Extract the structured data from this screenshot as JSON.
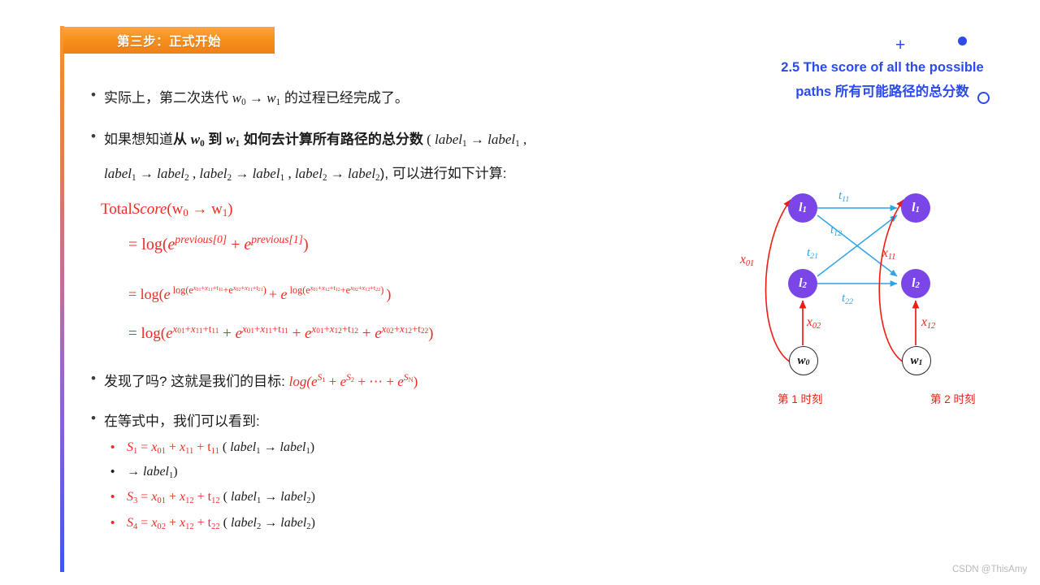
{
  "banner": {
    "title": "第三步：正式开始"
  },
  "right_heading": {
    "line1": "2.5 The score of all the possible",
    "line2": "paths 所有可能路径的总分数",
    "plus_glyph": "+",
    "dot_icon": "filled-dot",
    "circle_icon": "open-circle"
  },
  "bullets": {
    "b1": {
      "marker": "•",
      "pre": "实际上，第二次迭代 ",
      "w0": "w",
      "w0sub": "0",
      "arrow": " → ",
      "w1": "w",
      "w1sub": "1",
      "post": " 的过程已经完成了。"
    },
    "b2": {
      "marker": "•",
      "l1_pre": "如果想知道",
      "l1_bold_a": "从 ",
      "l1_w0": "w",
      "l1_w0sub": "0",
      "l1_bold_b": " 到 ",
      "l1_w1": "w",
      "l1_w1sub": "1",
      "l1_bold_c": " 如何去计算所有路径的总分数",
      "l1_tail": " ( ",
      "l1_lab1": "label",
      "l1_lab1sub": "1",
      "l1_arr": " → ",
      "l1_lab2": "label",
      "l1_lab2sub": "1",
      "l1_comma": " ,",
      "l2_a1": "label",
      "l2_a1sub": "1",
      "l2_arr1": " → ",
      "l2_a2": "label",
      "l2_a2sub": "2",
      "l2_c1": " , ",
      "l2_b1": "label",
      "l2_b1sub": "2",
      "l2_arr2": " → ",
      "l2_b2": "label",
      "l2_b2sub": "1",
      "l2_c2": " , ",
      "l2_d1": "label",
      "l2_d1sub": "2",
      "l2_arr3": " → ",
      "l2_d2": "label",
      "l2_d2sub": "2",
      "l2_tail": "), 可以进行如下计算:"
    },
    "b3": {
      "marker": "•",
      "pre": "发现了吗? 这就是我们的目标: ",
      "formula_log": "log(",
      "s1": "S",
      "s1sub": "1",
      "s2": "S",
      "s2sub": "2",
      "sn": "S",
      "snsub": "N"
    },
    "b4": {
      "marker": "•",
      "text": "在等式中，我们可以看到:"
    }
  },
  "formulas": {
    "f_head": {
      "total": "Total",
      "score": "Score",
      "open": "(",
      "w0": "w",
      "w0sub": "0",
      "arrow": " → ",
      "w1": "w",
      "w1sub": "1",
      "close": ")"
    },
    "f1": {
      "eq": "= log(",
      "e": "e",
      "prev0": "previous[0]",
      "plus": " + ",
      "prev1": "previous[1]",
      "close": ")"
    },
    "f2": {
      "eq": "= log(",
      "e": "e",
      "inner1": "log(e",
      "x01": "x",
      "x01sub": "01",
      "p": "+",
      "x11": "x",
      "x11sub": "11",
      "t11": "t",
      "t11sub": "11",
      "plus_e": "+e",
      "x02": "x",
      "x02sub": "02",
      "x11b": "x",
      "x11bsub": "11",
      "t21": "t",
      "t21sub": "21",
      "inner1close": ")",
      "mid_plus": " + ",
      "inner2": "log(e",
      "x01b": "x",
      "x01bsub": "01",
      "x12": "x",
      "x12sub": "12",
      "t12": "t",
      "t12sub": "12",
      "plus_e2": "+e",
      "x02b": "x",
      "x02bsub": "02",
      "x12b": "x",
      "x12bsub": "12",
      "t22": "t",
      "t22sub": "22",
      "inner2close": ")",
      "close": ")"
    },
    "f3": {
      "eq": "= log(",
      "terms": [
        {
          "x1": "x",
          "x1s": "01",
          "x2": "x",
          "x2s": "11",
          "t": "t",
          "ts": "11"
        },
        {
          "x1": "x",
          "x1s": "01",
          "x2": "x",
          "x2s": "11",
          "t": "t",
          "ts": "11"
        },
        {
          "x1": "x",
          "x1s": "01",
          "x2": "x",
          "x2s": "12",
          "t": "t",
          "ts": "12"
        },
        {
          "x1": "x",
          "x1s": "02",
          "x2": "x",
          "x2s": "12",
          "t": "t",
          "ts": "22"
        }
      ],
      "close": ")"
    }
  },
  "sub_bullets": [
    {
      "marker": "•",
      "color": "#EF2B24",
      "s": "S",
      "ssub": "1",
      "x1": "x",
      "x1s": "01",
      "x2": "x",
      "x2s": "11",
      "t": "t",
      "ts": "11",
      "lab_a": "label",
      "lab_as": "1",
      "lab_b": "label",
      "lab_bs": "1"
    },
    {
      "marker": "•",
      "color": "#1b1b1b",
      "only_tail": true,
      "lab_b": "label",
      "lab_bs": "1"
    },
    {
      "marker": "•",
      "color": "#EF2B24",
      "s": "S",
      "ssub": "3",
      "x1": "x",
      "x1s": "01",
      "x2": "x",
      "x2s": "12",
      "t": "t",
      "ts": "12",
      "lab_a": "label",
      "lab_as": "1",
      "lab_b": "label",
      "lab_bs": "2"
    },
    {
      "marker": "•",
      "color": "#EF2B24",
      "s": "S",
      "ssub": "4",
      "x1": "x",
      "x1s": "02",
      "x2": "x",
      "x2s": "12",
      "t": "t",
      "ts": "22",
      "lab_a": "label",
      "lab_as": "2",
      "lab_b": "label",
      "lab_bs": "2"
    }
  ],
  "diagram": {
    "nodes": {
      "l1_left": "l",
      "l1_left_sub": "1",
      "l2_left": "l",
      "l2_left_sub": "2",
      "l1_right": "l",
      "l1_right_sub": "1",
      "l2_right": "l",
      "l2_right_sub": "2",
      "w0": "w",
      "w0_sub": "0",
      "w1": "w",
      "w1_sub": "1"
    },
    "transition_labels": [
      {
        "name": "t11",
        "base": "t",
        "sub": "11"
      },
      {
        "name": "t12",
        "base": "t",
        "sub": "12"
      },
      {
        "name": "t21",
        "base": "t",
        "sub": "21"
      },
      {
        "name": "t22",
        "base": "t",
        "sub": "22"
      }
    ],
    "emission_labels": [
      {
        "name": "x01",
        "base": "x",
        "sub": "01"
      },
      {
        "name": "x02",
        "base": "x",
        "sub": "02"
      },
      {
        "name": "x11",
        "base": "x",
        "sub": "11"
      },
      {
        "name": "x12",
        "base": "x",
        "sub": "12"
      }
    ],
    "time_labels": [
      "第 1 时刻",
      "第 2 时刻"
    ],
    "colors": {
      "node": "#7B46E8",
      "transition": "#2EA3E8",
      "emission": "#EE1C12"
    }
  },
  "watermark": "CSDN @ThisAmy"
}
